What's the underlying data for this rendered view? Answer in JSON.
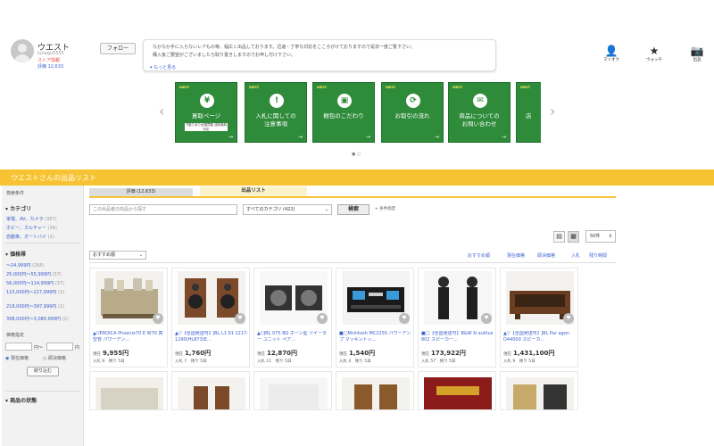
{
  "seller": {
    "name": "ウエスト",
    "id": "lunagu5555",
    "store_label": "ストア情報",
    "rating": "評価 12,633",
    "follow_label": "フォロー"
  },
  "notice": {
    "line1": "なかなか手に入らないレアもの等、幅広く出品しております。迅速・丁寧な対応をこころがけておりますので是非一度ご覧下さい。",
    "line2": "購入後ご要望がございましたら取り置きしますのでお申し付け下さい。",
    "more": "もっと見る"
  },
  "top_icons": [
    {
      "icon": "user-icon",
      "label": "マイオク",
      "glyph": "👤"
    },
    {
      "icon": "star-icon",
      "label": "ウォッチ",
      "glyph": "★"
    },
    {
      "icon": "camera-icon",
      "label": "出品",
      "glyph": "📷"
    }
  ],
  "banners": [
    {
      "logo": "WEST",
      "icon": "¥",
      "title": "買取ページ",
      "sub": "下取りあり全国買取 送料無料対応"
    },
    {
      "logo": "WEST",
      "icon": "!",
      "title": "入札に関しての\n注意事項"
    },
    {
      "logo": "WEST",
      "icon": "▣",
      "title": "梱包のこだわり"
    },
    {
      "logo": "WEST",
      "icon": "⟳",
      "title": "お取引の流れ"
    },
    {
      "logo": "WEST",
      "icon": "✉",
      "title": "商品についての\nお問い合わせ"
    },
    {
      "logo": "WEST",
      "icon": "",
      "title": "店"
    }
  ],
  "list_title": "ウエストさんの出品リスト",
  "tabs": {
    "rating": "評価 (12,633)",
    "list": "出品リスト"
  },
  "search": {
    "placeholder": "この出品者の商品から探す",
    "category": "すべてのカテゴリ (422)",
    "button": "検索",
    "conditions": "条件指定"
  },
  "view": {
    "per_page": "50件"
  },
  "sort": {
    "selected": "おすすめ順",
    "links": [
      "おすすめ順",
      "現在価格",
      "即決価格",
      "入札",
      "残り時間"
    ]
  },
  "sidebar": {
    "search_ops": "検索条件",
    "category_head": "カテゴリ",
    "categories": [
      {
        "name": "家電、AV、カメラ",
        "count": "(367)"
      },
      {
        "name": "ホビー、カルチャー",
        "count": "(34)"
      },
      {
        "name": "自動車、オートバイ",
        "count": "(1)"
      }
    ],
    "price_head": "価格帯",
    "prices": [
      {
        "name": "〜24,999円",
        "count": "(265)"
      },
      {
        "name": "25,000円〜55,999円",
        "count": "(37)"
      },
      {
        "name": "56,000円〜114,999円",
        "count": "(37)"
      },
      {
        "name": "115,000円〜217,999円",
        "count": "(3)"
      },
      {
        "name": "218,000円〜397,999円",
        "count": "(2)"
      },
      {
        "name": "398,000円〜3,080,999円",
        "count": "(2)"
      }
    ],
    "price_spec": "価格指定",
    "yen": "円〜",
    "yen2": "円",
    "radio1": "現在価格",
    "radio2": "即決価格",
    "narrow": "絞り込む",
    "condition_head": "商品の状態"
  },
  "products": [
    {
      "title": "▲!/EROICA Phoenix70 E W70 真空管 パワーアン...",
      "price": "9,955円",
      "bids": "入札 9",
      "remain": "残り 5日"
    },
    {
      "title": "▲▽【全国発送可】JBL L1 01 1217-1290(HL873)E...",
      "price": "1,760円",
      "bids": "入札 7",
      "remain": "残り 5日"
    },
    {
      "title": "▲▽JBL 075 8Ω ホーン型 ツイーター ユニット ペア...",
      "price": "12,870円",
      "bids": "入札 11",
      "remain": "残り 5日"
    },
    {
      "title": "■□McIntosh MC2255 パワーアンプ マッキントッ...",
      "price": "1,540円",
      "bids": "入札 4",
      "remain": "残り 5日"
    },
    {
      "title": "■□【全国発送可】B&W N autilus 802 スピーカー...",
      "price": "173,922円",
      "bids": "入札 57",
      "remain": "残り 5日"
    },
    {
      "title": "▲▽【全国発送可】JBL Par agon D44000 スピーカ...",
      "price": "1,431,100円",
      "bids": "入札 9",
      "remain": "残り 5日"
    }
  ],
  "price_label": "現在"
}
